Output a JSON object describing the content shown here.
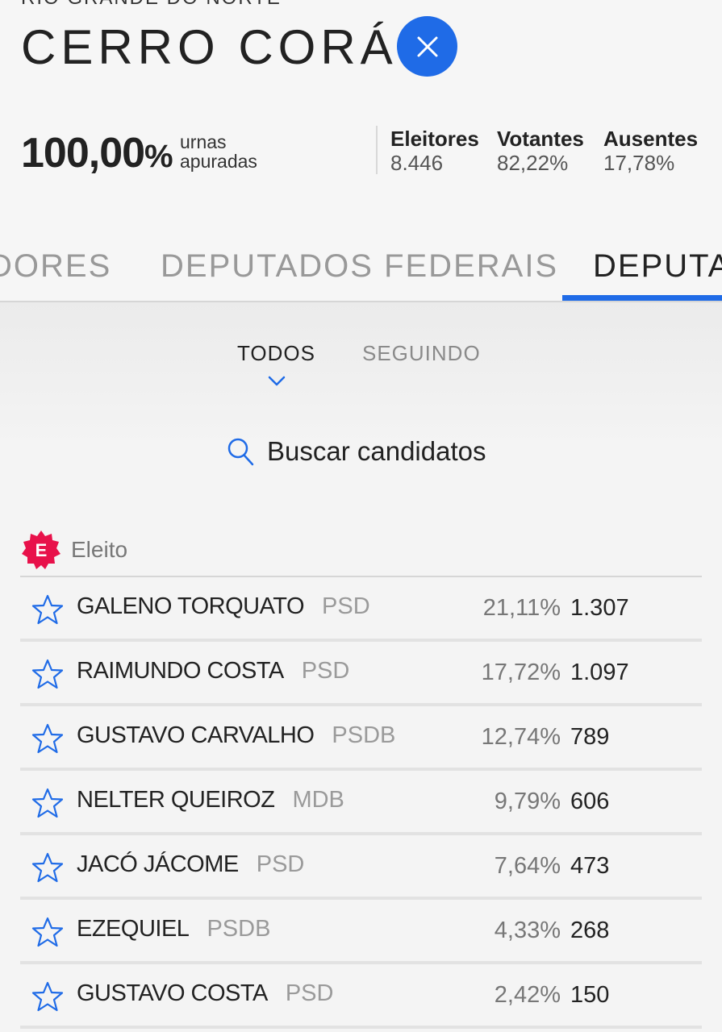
{
  "header": {
    "state": "RIO GRANDE DO NORTE",
    "city": "CERRO CORÁ",
    "close_icon": "close-icon"
  },
  "summary": {
    "percent_value": "100,00",
    "percent_sign": "%",
    "urnas_line1": "urnas",
    "urnas_line2": "apuradas",
    "eleitores_label": "Eleitores",
    "eleitores_value": "8.446",
    "votantes_label": "Votantes",
    "votantes_value": "82,22%",
    "ausentes_label": "Ausentes",
    "ausentes_value": "17,78%"
  },
  "tabs": [
    {
      "label": "DORES",
      "active": false
    },
    {
      "label": "DEPUTADOS FEDERAIS",
      "active": false
    },
    {
      "label": "DEPUTA",
      "active": true
    }
  ],
  "filters": {
    "todos": "TODOS",
    "seguindo": "SEGUINDO"
  },
  "search": {
    "label": "Buscar candidatos"
  },
  "legend": {
    "badge": "E",
    "label": "Eleito",
    "badge_color": "#e8114a"
  },
  "accent_color": "#1f6be7",
  "candidates": [
    {
      "name": "GALENO TORQUATO",
      "party": "PSD",
      "percent": "21,11%",
      "votes": "1.307"
    },
    {
      "name": "RAIMUNDO COSTA",
      "party": "PSD",
      "percent": "17,72%",
      "votes": "1.097"
    },
    {
      "name": "GUSTAVO CARVALHO",
      "party": "PSDB",
      "percent": "12,74%",
      "votes": "789"
    },
    {
      "name": "NELTER QUEIROZ",
      "party": "MDB",
      "percent": "9,79%",
      "votes": "606"
    },
    {
      "name": "JACÓ JÁCOME",
      "party": "PSD",
      "percent": "7,64%",
      "votes": "473"
    },
    {
      "name": "EZEQUIEL",
      "party": "PSDB",
      "percent": "4,33%",
      "votes": "268"
    },
    {
      "name": "GUSTAVO COSTA",
      "party": "PSD",
      "percent": "2,42%",
      "votes": "150"
    }
  ]
}
